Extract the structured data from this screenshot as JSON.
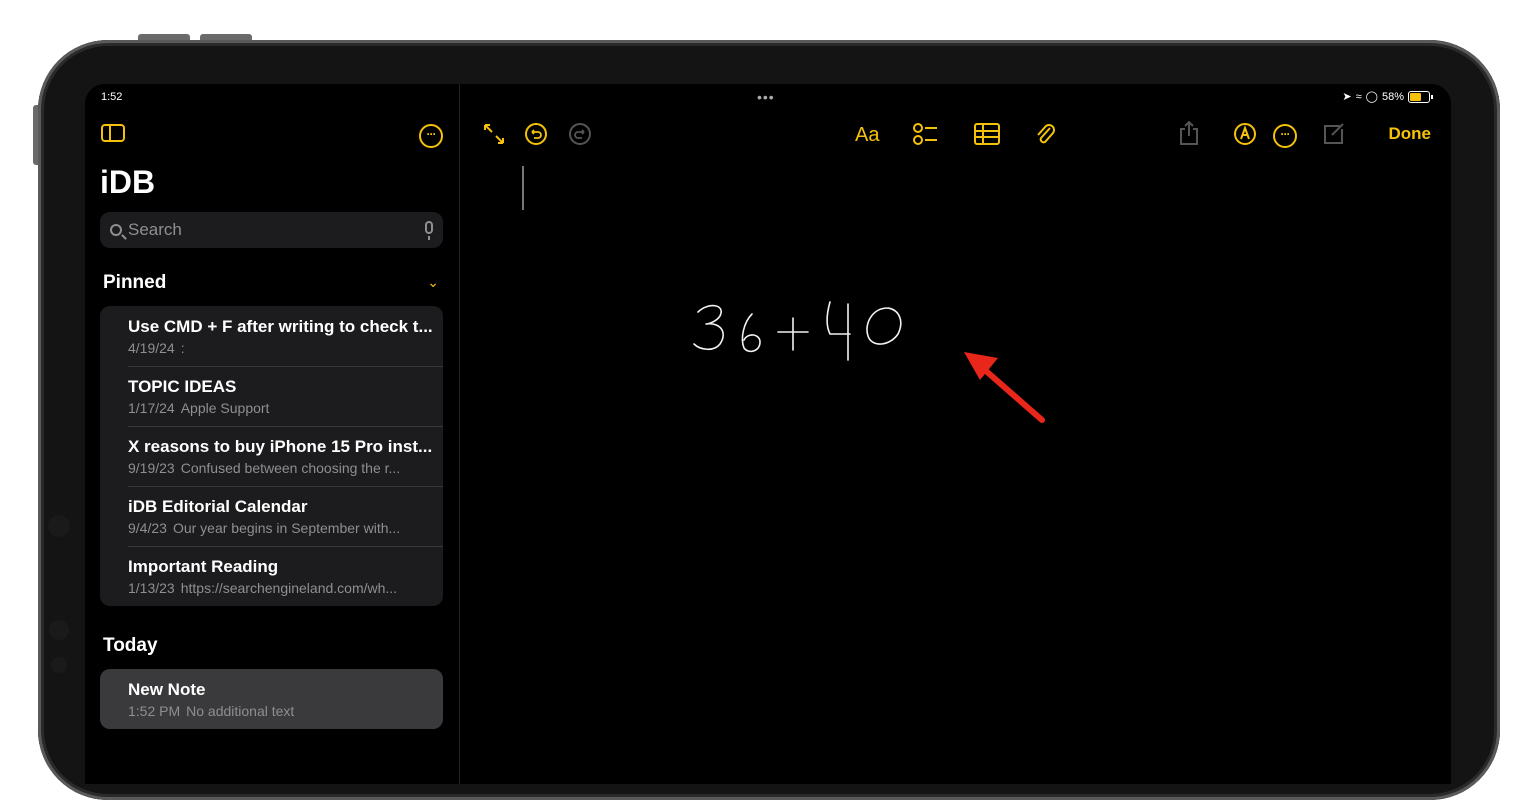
{
  "status": {
    "time": "1:52",
    "battery": "58%"
  },
  "sidebar": {
    "title": "iDB",
    "search_placeholder": "Search",
    "pinned_header": "Pinned",
    "today_header": "Today",
    "pinned_notes": [
      {
        "title": "Use CMD + F after writing to check t...",
        "date": "4/19/24",
        "preview": ":"
      },
      {
        "title": "TOPIC IDEAS",
        "date": "1/17/24",
        "preview": "Apple Support"
      },
      {
        "title": "X reasons to buy iPhone 15 Pro inst...",
        "date": "9/19/23",
        "preview": "Confused between choosing the r..."
      },
      {
        "title": "iDB Editorial Calendar",
        "date": "9/4/23",
        "preview": "Our year begins in September with..."
      },
      {
        "title": "Important Reading",
        "date": "1/13/23",
        "preview": "https://searchengineland.com/wh..."
      }
    ],
    "today_notes": [
      {
        "title": "New Note",
        "date": "1:52 PM",
        "preview": "No additional text"
      }
    ]
  },
  "editor": {
    "format_label": "Aa",
    "done_label": "Done",
    "handwriting": "36+40"
  },
  "colors": {
    "accent": "#f5c20b",
    "annotation_arrow": "#e8261a"
  }
}
